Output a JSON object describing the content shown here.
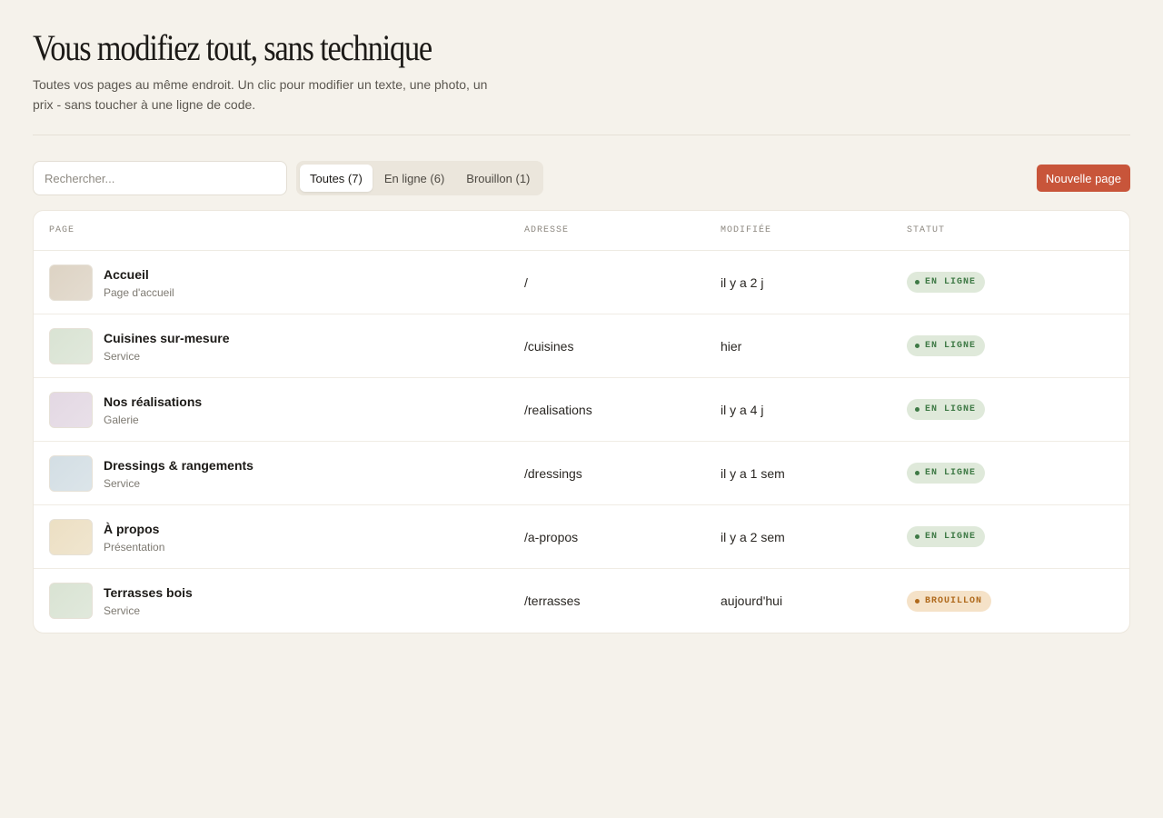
{
  "header": {
    "title": "Vous modifiez tout, sans technique",
    "subtitle": "Toutes vos pages au même endroit. Un clic pour modifier un texte, une photo, un prix - sans toucher à une ligne de code."
  },
  "toolbar": {
    "search_placeholder": "Rechercher...",
    "filters": [
      {
        "label": "Toutes (7)",
        "active": true
      },
      {
        "label": "En ligne (6)",
        "active": false
      },
      {
        "label": "Brouillon (1)",
        "active": false
      }
    ],
    "new_page_label": "Nouvelle page"
  },
  "table": {
    "columns": [
      "PAGE",
      "ADRESSE",
      "MODIFIÉE",
      "STATUT"
    ],
    "rows": [
      {
        "name": "Accueil",
        "type": "Page d'accueil",
        "address": "/",
        "modified": "il y a 2 j",
        "status": "EN LIGNE",
        "status_kind": "online",
        "thumb_color": "#ddd3c4"
      },
      {
        "name": "Cuisines sur-mesure",
        "type": "Service",
        "address": "/cuisines",
        "modified": "hier",
        "status": "EN LIGNE",
        "status_kind": "online",
        "thumb_color": "#d9e3d3"
      },
      {
        "name": "Nos réalisations",
        "type": "Galerie",
        "address": "/realisations",
        "modified": "il y a 4 j",
        "status": "EN LIGNE",
        "status_kind": "online",
        "thumb_color": "#e3d8e3"
      },
      {
        "name": "Dressings & rangements",
        "type": "Service",
        "address": "/dressings",
        "modified": "il y a 1 sem",
        "status": "EN LIGNE",
        "status_kind": "online",
        "thumb_color": "#d3dee4"
      },
      {
        "name": "À propos",
        "type": "Présentation",
        "address": "/a-propos",
        "modified": "il y a 2 sem",
        "status": "EN LIGNE",
        "status_kind": "online",
        "thumb_color": "#ecdfc3"
      },
      {
        "name": "Terrasses bois",
        "type": "Service",
        "address": "/terrasses",
        "modified": "aujourd'hui",
        "status": "BROUILLON",
        "status_kind": "draft",
        "thumb_color": "#d9e3d3"
      }
    ]
  },
  "colors": {
    "background": "#f5f2eb",
    "accent": "#c8553a",
    "online_bg": "#dfe9da",
    "online_text": "#3f7a46",
    "draft_bg": "#f5e2c8",
    "draft_text": "#b06a1d"
  }
}
